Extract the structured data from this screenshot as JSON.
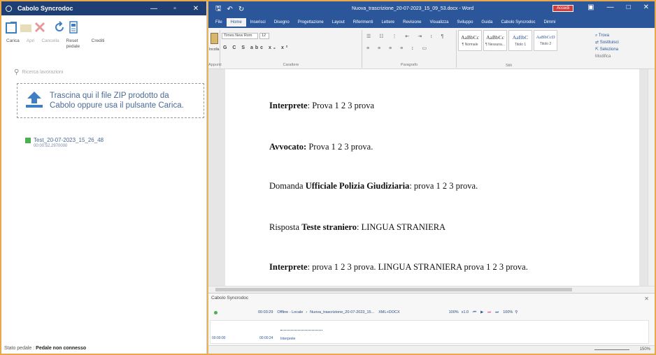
{
  "left_panel": {
    "title": "Cabolo Syncrodoc",
    "toolbar": {
      "buttons": [
        {
          "label": "Carica",
          "icon": "upload-icon"
        },
        {
          "label": "Apri",
          "icon": "folder-icon"
        },
        {
          "label": "Cancella",
          "icon": "delete-icon"
        },
        {
          "label": "Reset pedale",
          "icon": "reset-icon"
        },
        {
          "label": "Crediti",
          "icon": "info-icon"
        }
      ]
    },
    "search_placeholder": "Ricerca lavorazioni",
    "drop_zone": {
      "line1": "Trascina qui il file ZIP prodotto da",
      "line2": "Cabolo oppure usa il pulsante Carica."
    },
    "file": {
      "name": "Test_20-07-2023_15_26_48",
      "duration": "00:00:52.2970000"
    },
    "status_label": "Stato pedale :",
    "status_value": "Pedale non connesso"
  },
  "word": {
    "title": "Nuova_trascrizione_20-07-2023_15_09_53.docx - Word",
    "account_button": "Accedi",
    "tabs": [
      "File",
      "Home",
      "Inserisci",
      "Disegno",
      "Progettazione",
      "Layout",
      "Riferimenti",
      "Lettere",
      "Revisione",
      "Visualizza",
      "Sviluppo",
      "Guida",
      "Cabolo Syncrodoc",
      "Dimmi"
    ],
    "ribbon": {
      "clipboard_label": "Appunti",
      "paste_label": "Incolla",
      "font_name": "Times New Rom",
      "font_size": "12",
      "font_group_label": "Carattere",
      "paragraph_label": "Paragrafo",
      "styles_label": "Stili",
      "styles": [
        {
          "sample": "AaBbCc",
          "name": "¶ Normale"
        },
        {
          "sample": "AaBbCc",
          "name": "¶ Nessuna..."
        },
        {
          "sample": "AaBbC",
          "name": "Titolo 1"
        },
        {
          "sample": "AaBbCcD",
          "name": "Titolo 2"
        }
      ],
      "edit": {
        "find": "Trova",
        "replace": "Sostituisci",
        "select": "Seleziona",
        "label": "Modifica"
      }
    },
    "document": {
      "paragraphs": [
        {
          "bold": "Interprete",
          "rest": ": Prova 1 2 3 prova"
        },
        {
          "bold": "Avvocato:",
          "rest": " Prova 1 2 3 prova."
        },
        {
          "pre": "Domanda ",
          "bold": "Ufficiale Polizia Giudiziaria",
          "rest": ": prova 1 2 3 prova."
        },
        {
          "pre": "Risposta ",
          "bold": "Teste straniero",
          "rest": ": LINGUA STRANIERA"
        },
        {
          "bold": "Interprete",
          "rest": ": prova 1 2 3 prova. LINGUA STRANIERA prova 1 2 3 prova."
        }
      ]
    },
    "cabolo": {
      "title": "Cabolo Syncrodoc",
      "time": "00:03:29",
      "mode": "Offline - Locale",
      "doc": "Nuova_trascrizione_20-07-2023_15...",
      "format": "XML+DOCX",
      "volume": "100%",
      "speed": "x1.0",
      "zoom": "100%",
      "timeline_start": "00:00:00",
      "timeline_mark": "00:00:24",
      "speaker": "Interprete"
    },
    "statusbar": {
      "zoom": "150%"
    }
  },
  "colors": {
    "word_blue": "#2b579a",
    "left_title": "#1f3f74",
    "frame": "#e9a94b",
    "file_green": "#4cb050"
  }
}
